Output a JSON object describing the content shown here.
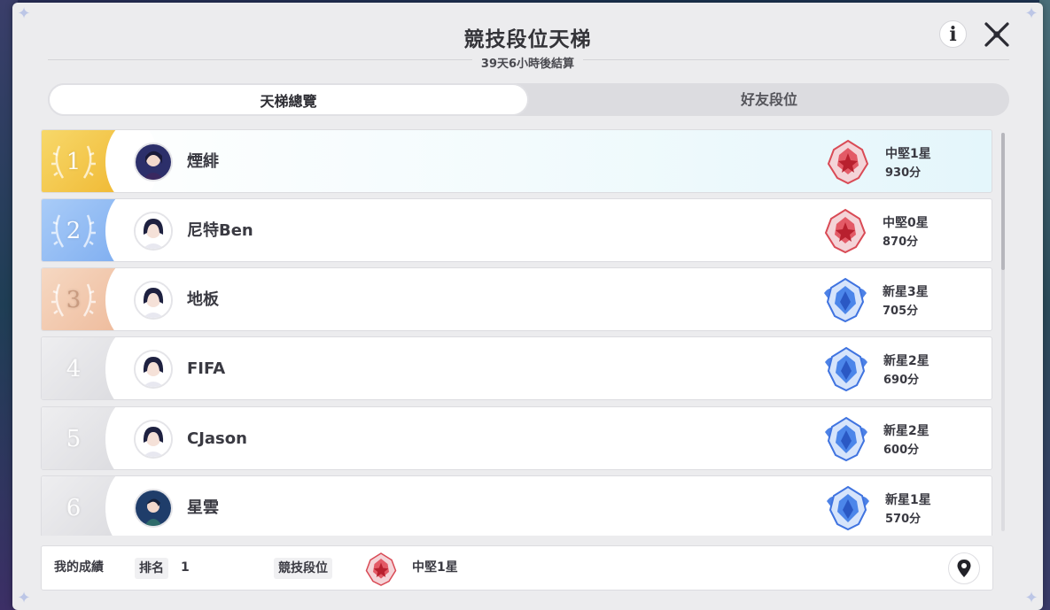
{
  "window": {
    "title": "競技段位天梯",
    "countdown": "39天6小時後結算"
  },
  "tabs": [
    {
      "label": "天梯總覽",
      "active": true
    },
    {
      "label": "好友段位",
      "active": false
    }
  ],
  "icons": {
    "info": "info-icon",
    "close": "close-icon",
    "location": "location-pin-icon"
  },
  "ranking": [
    {
      "rank": "1",
      "name": "煙緋",
      "tier": "中堅1星",
      "score": "930分",
      "tier_kind": "red",
      "rank_color": "#f2c64a"
    },
    {
      "rank": "2",
      "name": "尼特Ben",
      "tier": "中堅0星",
      "score": "870分",
      "tier_kind": "red",
      "rank_color": "#8fb9f2"
    },
    {
      "rank": "3",
      "name": "地板",
      "tier": "新星3星",
      "score": "705分",
      "tier_kind": "blue",
      "rank_color": "#f0c9ae"
    },
    {
      "rank": "4",
      "name": "FIFA",
      "tier": "新星2星",
      "score": "690分",
      "tier_kind": "blue",
      "rank_color": "#e2e2e4"
    },
    {
      "rank": "5",
      "name": "CJason",
      "tier": "新星2星",
      "score": "600分",
      "tier_kind": "blue",
      "rank_color": "#e2e2e4"
    },
    {
      "rank": "6",
      "name": "星雲",
      "tier": "新星1星",
      "score": "570分",
      "tier_kind": "blue",
      "rank_color": "#e2e2e4"
    }
  ],
  "my_record": {
    "label": "我的成績",
    "rank_label": "排名",
    "rank_value": "1",
    "tier_label": "競技段位",
    "tier_value": "中堅1星"
  },
  "colors": {
    "panel_bg": "#ececee",
    "tier_red": "#d94a55",
    "tier_blue": "#3f73e0",
    "gold": "#f2c64a",
    "silver_blue": "#8fb9f2",
    "bronze": "#f0c9ae"
  }
}
